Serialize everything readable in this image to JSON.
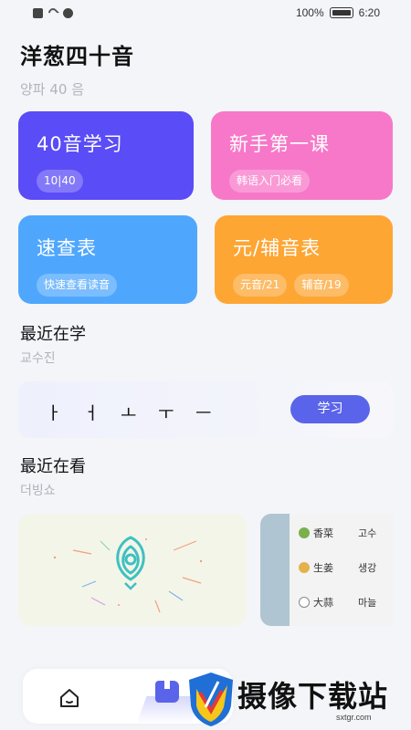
{
  "status": {
    "battery_text": "100%",
    "time": "6:20"
  },
  "header": {
    "title": "洋葱四十音",
    "subtitle": "양파 40 음"
  },
  "cards": {
    "learn": {
      "title": "40音学习",
      "chips": [
        "10|40"
      ],
      "color": "#5a4cf6"
    },
    "first_lesson": {
      "title": "新手第一课",
      "chips": [
        "韩语入门必看"
      ],
      "color": "#f778c8"
    },
    "quick_table": {
      "title": "速查表",
      "chips": [
        "快速查看读音"
      ],
      "color": "#4fa7fd"
    },
    "vowel_table": {
      "title": "元/辅音表",
      "chips": [
        "元音/21",
        "辅音/19"
      ],
      "color": "#fda634"
    }
  },
  "recent_learning": {
    "title": "最近在学",
    "subtitle": "교수진",
    "letters": [
      "ㅏ",
      "ㅓ",
      "ㅗ",
      "ㅜ",
      "ㅡ"
    ],
    "study_button": "学习",
    "accent": "#5a64ea"
  },
  "recent_watching": {
    "title": "最近在看",
    "subtitle": "더빙쇼",
    "vegetables": [
      {
        "zh": "香菜",
        "ko": "고수",
        "icon": "cilantro-icon"
      },
      {
        "zh": "生姜",
        "ko": "생강",
        "icon": "ginger-icon"
      },
      {
        "zh": "大蒜",
        "ko": "마늘",
        "icon": "garlic-icon"
      }
    ]
  },
  "nav": {
    "items": [
      "home-icon",
      "book-icon"
    ]
  },
  "watermark": {
    "text": "摄像下载站",
    "url": "sxtgr.com"
  }
}
